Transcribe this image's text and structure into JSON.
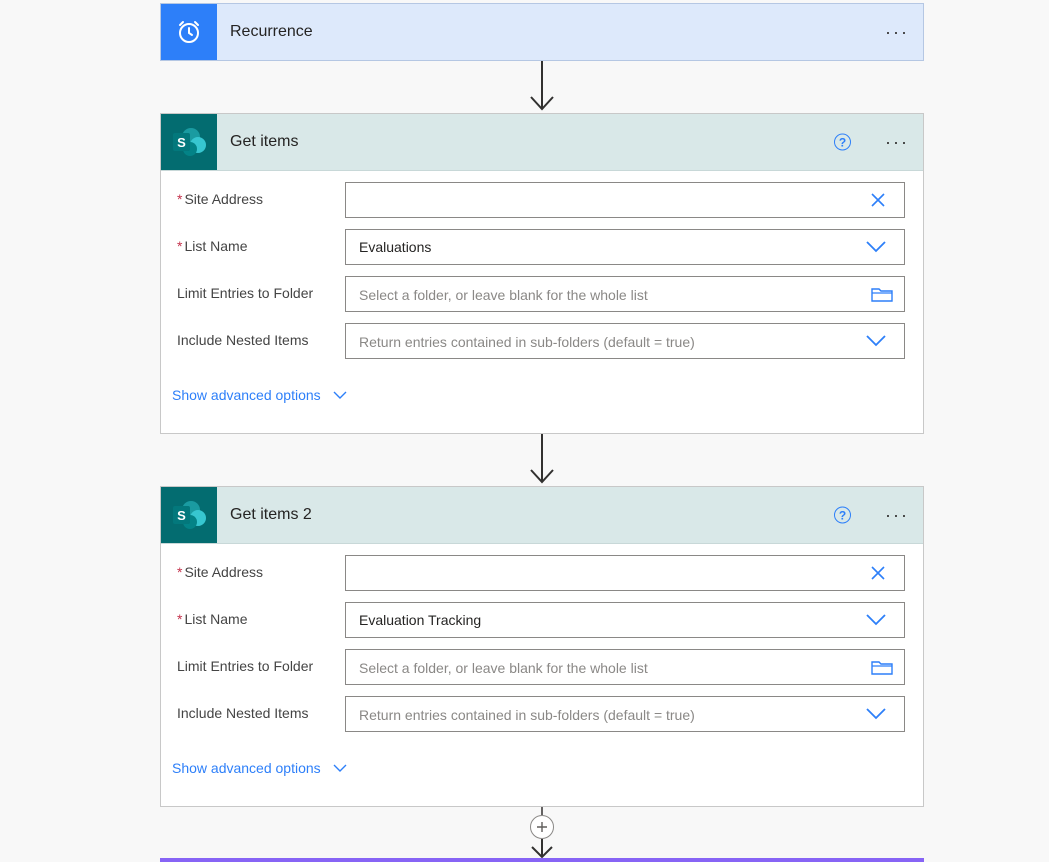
{
  "recurrence": {
    "title": "Recurrence",
    "more": "···"
  },
  "get_items": {
    "title": "Get items",
    "help": "?",
    "more": "···",
    "fields": {
      "site_address": {
        "label": "Site Address",
        "value": ""
      },
      "list_name": {
        "label": "List Name",
        "value": "Evaluations"
      },
      "limit_entries": {
        "label": "Limit Entries to Folder",
        "placeholder": "Select a folder, or leave blank for the whole list"
      },
      "include_nested": {
        "label": "Include Nested Items",
        "placeholder": "Return entries contained in sub-folders (default = true)"
      }
    },
    "advanced": "Show advanced options"
  },
  "get_items_2": {
    "title": "Get items 2",
    "help": "?",
    "more": "···",
    "fields": {
      "site_address": {
        "label": "Site Address",
        "value": ""
      },
      "list_name": {
        "label": "List Name",
        "value": "Evaluation Tracking"
      },
      "limit_entries": {
        "label": "Limit Entries to Folder",
        "placeholder": "Select a folder, or leave blank for the whole list"
      },
      "include_nested": {
        "label": "Include Nested Items",
        "placeholder": "Return entries contained in sub-folders (default = true)"
      }
    },
    "advanced": "Show advanced options"
  },
  "required_marker": "*",
  "colors": {
    "recurrence_header": "#dde9fb",
    "recurrence_icon_bg": "#2d7ff9",
    "sharepoint_header": "#d9e8e8",
    "sharepoint_icon_bg": "#036c70",
    "link_blue": "#2d7ff9",
    "required_red": "#c4314b"
  }
}
